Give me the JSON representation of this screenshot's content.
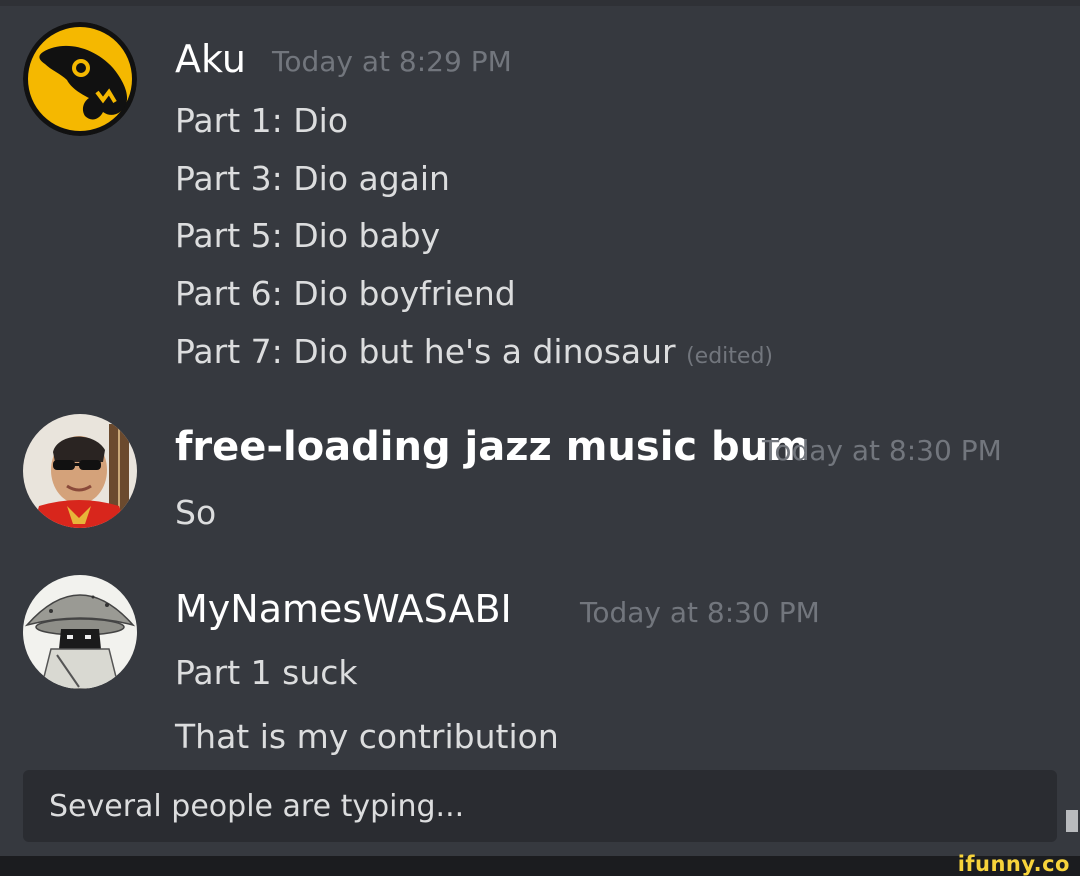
{
  "messages": [
    {
      "username": "Aku",
      "timestamp": "Today at 8:29 PM",
      "lines": [
        "Part 1: Dio",
        "Part 3: Dio again",
        "Part 5: Dio baby",
        "Part 6: Dio boyfriend",
        "Part 7: Dio but he's a dinosaur"
      ],
      "edited_label": "(edited)",
      "avatar": "aku-logo-icon",
      "avatar_color": "#f5b800"
    },
    {
      "username": "free-loading jazz music bum",
      "timestamp": "Today at 8:30 PM",
      "lines": [
        "So"
      ],
      "avatar": "sunglasses-man-photo"
    },
    {
      "username": "MyNamesWASABI",
      "timestamp": "Today at 8:30 PM",
      "lines": [
        "Part 1 suck",
        "That is my contribution"
      ],
      "avatar": "wide-hat-creature-drawing"
    }
  ],
  "typing_indicator": "Several people are typing...",
  "watermark": "ifunny.co",
  "colors": {
    "background": "#36393f",
    "username": "#ffffff",
    "message_text": "#dcddde",
    "timestamp": "#72767d",
    "typing_bar": "#2a2c31",
    "watermark": "#f7d33b"
  }
}
